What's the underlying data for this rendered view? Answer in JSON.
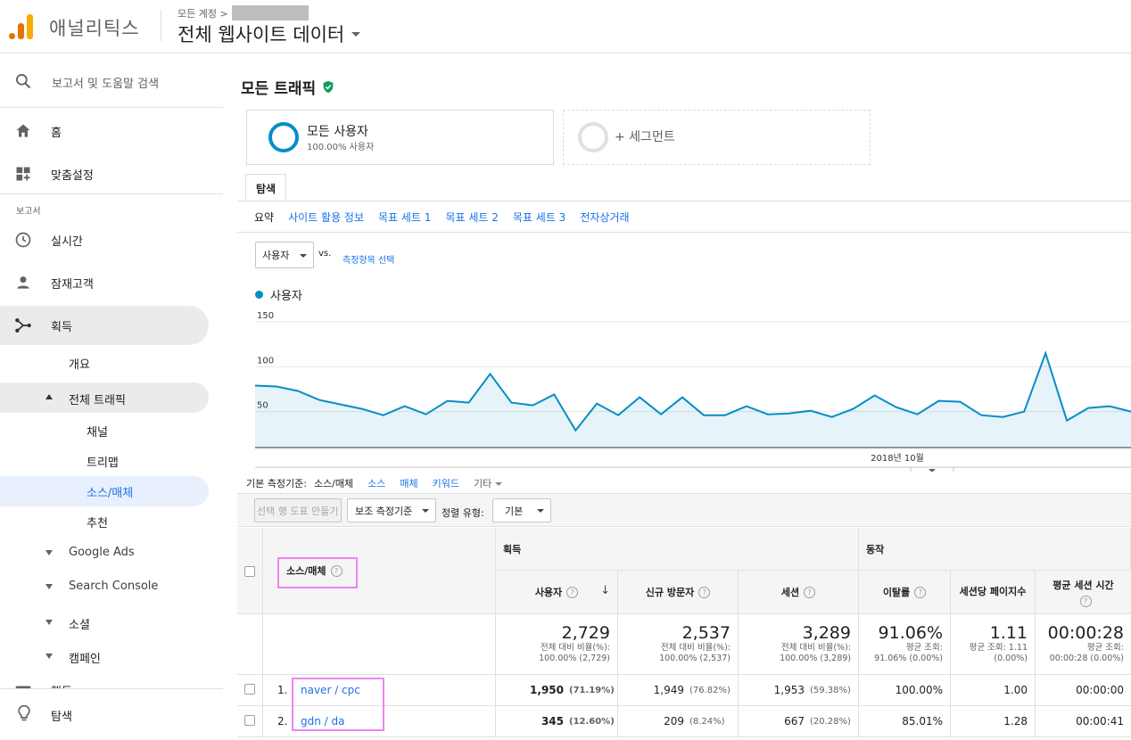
{
  "header": {
    "app_name": "애널리틱스",
    "account_label": "모든 계정 >",
    "property": "전체 웹사이트 데이터"
  },
  "sidebar": {
    "search": "보고서 및 도움말 검색",
    "home": "홈",
    "customization": "맞춤설정",
    "reports_section": "보고서",
    "realtime": "실시간",
    "audience": "잠재고객",
    "acquisition": "획득",
    "overview": "개요",
    "all_traffic": "전체 트래픽",
    "channels": "채널",
    "treemaps": "트리맵",
    "source_medium": "소스/매체",
    "referrals": "추천",
    "google_ads": "Google Ads",
    "search_console": "Search Console",
    "social": "소셜",
    "campaigns": "캠페인",
    "behavior": "행동",
    "discover": "탐색"
  },
  "main": {
    "title": "모든 트래픽",
    "segment_name": "모든 사용자",
    "segment_pct": "100.00% 사용자",
    "add_segment": "+ 세그먼트",
    "explorer_tab": "탐색",
    "subtabs": [
      "요약",
      "사이트 활용 정보",
      "목표 세트 1",
      "목표 세트 2",
      "목표 세트 3",
      "전자상거래"
    ],
    "metric_select": "사용자",
    "vs": "vs.",
    "metric_pick": "측정항목 선택",
    "legend": "사용자",
    "dims_label": "기본 측정기준:",
    "dims": [
      "소스/매체",
      "소스",
      "매체",
      "키워드",
      "기타"
    ],
    "btn_create": "선택 행 도표 만들기",
    "btn_secondary": "보조 측정기준",
    "sort_label": "정렬 유형:",
    "sort_value": "기본"
  },
  "chart_data": {
    "type": "line",
    "series": [
      {
        "name": "사용자",
        "values": [
          79,
          78,
          73,
          63,
          58,
          53,
          46,
          56,
          47,
          62,
          60,
          92,
          60,
          57,
          69,
          29,
          59,
          46,
          66,
          47,
          66,
          46,
          46,
          56,
          47,
          48,
          51,
          44,
          53,
          68,
          55,
          47,
          62,
          61,
          46,
          44,
          50,
          115,
          40,
          54,
          56,
          50
        ]
      }
    ],
    "yticks": [
      "50",
      "100",
      "150"
    ],
    "xtick": "2018년 10월",
    "ylim": [
      0,
      150
    ],
    "grid": true,
    "color": "#058dc7"
  },
  "table": {
    "col_source": "소스/매체",
    "grp_acq": "획득",
    "grp_beh": "동작",
    "col_users": "사용자",
    "col_new": "신규 방문자",
    "col_sessions": "세션",
    "col_bounce": "이탈률",
    "col_pps": "세션당 페이지수",
    "col_dur": "평균 세션 시간",
    "totals": {
      "users": "2,729",
      "users_l1": "전체 대비 비율(%):",
      "users_l2": "100.00% (2,729)",
      "new": "2,537",
      "new_l1": "전체 대비 비율(%):",
      "new_l2": "100.00% (2,537)",
      "sessions": "3,289",
      "sessions_l1": "전체 대비 비율(%):",
      "sessions_l2": "100.00% (3,289)",
      "bounce": "91.06%",
      "bounce_l1": "평균 조회:",
      "bounce_l2": "91.06% (0.00%)",
      "pps": "1.11",
      "pps_l1": "평균 조회: 1.11",
      "pps_l2": "(0.00%)",
      "dur": "00:00:28",
      "dur_l1": "평균 조회:",
      "dur_l2": "00:00:28 (0.00%)"
    },
    "rows": [
      {
        "num": "1.",
        "source": "naver / cpc",
        "users": "1,950",
        "users_pct": "(71.19%)",
        "new": "1,949",
        "new_pct": "(76.82%)",
        "sessions": "1,953",
        "sessions_pct": "(59.38%)",
        "bounce": "100.00%",
        "pps": "1.00",
        "dur": "00:00:00"
      },
      {
        "num": "2.",
        "source": "gdn / da",
        "users": "345",
        "users_pct": "(12.60%)",
        "new": "209",
        "new_pct": "(8.24%)",
        "sessions": "667",
        "sessions_pct": "(20.28%)",
        "bounce": "85.01%",
        "pps": "1.28",
        "dur": "00:00:41"
      }
    ]
  }
}
